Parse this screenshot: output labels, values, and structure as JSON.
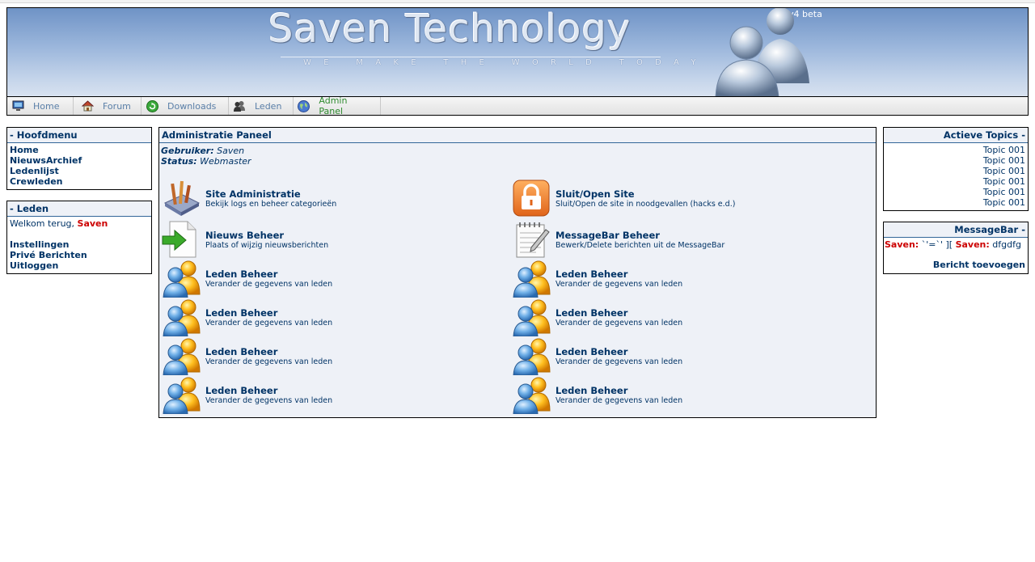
{
  "header": {
    "site_title": "Saven Technology",
    "tagline": "WE MAKE THE WORLD TODAY",
    "version": "v4 beta"
  },
  "nav": [
    {
      "label": "Home",
      "icon": "monitor-icon"
    },
    {
      "label": "Forum",
      "icon": "house-icon"
    },
    {
      "label": "Downloads",
      "icon": "refresh-icon"
    },
    {
      "label": "Leden",
      "icon": "users-icon"
    },
    {
      "label": "Admin Panel",
      "icon": "globe-icon",
      "active": true
    }
  ],
  "hoofdmenu": {
    "title": "- Hoofdmenu",
    "items": [
      "Home",
      "NieuwsArchief",
      "Ledenlijst",
      "Crewleden"
    ]
  },
  "leden_box": {
    "title": "- Leden",
    "welcome": "Welkom terug,",
    "username": "Saven",
    "links": [
      "Instellingen",
      "Privé Berichten",
      "Uitloggen"
    ]
  },
  "panel": {
    "title": "Administratie Paneel",
    "user_label": "Gebruiker:",
    "user_value": "Saven",
    "status_label": "Status:",
    "status_value": "Webmaster",
    "items": [
      {
        "title": "Site Administratie",
        "desc": "Bekijk logs en beheer categorieën",
        "icon": "settings-tools-icon"
      },
      {
        "title": "Sluit/Open Site",
        "desc": "Sluit/Open de site in noodgevallen (hacks e.d.)",
        "icon": "lock-icon"
      },
      {
        "title": "Nieuws Beheer",
        "desc": "Plaats of wijzig nieuwsberichten",
        "icon": "document-arrow-icon"
      },
      {
        "title": "MessageBar Beheer",
        "desc": "Bewerk/Delete berichten uit de MessageBar",
        "icon": "notepad-icon"
      },
      {
        "title": "Leden Beheer",
        "desc": "Verander de gegevens van leden",
        "icon": "users-icon"
      },
      {
        "title": "Leden Beheer",
        "desc": "Verander de gegevens van leden",
        "icon": "users-icon"
      },
      {
        "title": "Leden Beheer",
        "desc": "Verander de gegevens van leden",
        "icon": "users-icon"
      },
      {
        "title": "Leden Beheer",
        "desc": "Verander de gegevens van leden",
        "icon": "users-icon"
      },
      {
        "title": "Leden Beheer",
        "desc": "Verander de gegevens van leden",
        "icon": "users-icon"
      },
      {
        "title": "Leden Beheer",
        "desc": "Verander de gegevens van leden",
        "icon": "users-icon"
      },
      {
        "title": "Leden Beheer",
        "desc": "Verander de gegevens van leden",
        "icon": "users-icon"
      },
      {
        "title": "Leden Beheer",
        "desc": "Verander de gegevens van leden",
        "icon": "users-icon"
      }
    ]
  },
  "topics": {
    "title": "Actieve Topics -",
    "items": [
      "Topic 001",
      "Topic 001",
      "Topic 001",
      "Topic 001",
      "Topic 001",
      "Topic 001"
    ]
  },
  "messagebar": {
    "title": "MessageBar -",
    "msg1_user": "Saven:",
    "msg1_text": "`'=`' ][",
    "msg2_user": "Saven:",
    "msg2_text": "dfgdfg",
    "add_link": "Bericht toevoegen"
  },
  "colors": {
    "link": "#003366",
    "username": "#cc0000",
    "active_nav": "#2e8a2e",
    "panel_bg": "#eef1f7"
  }
}
